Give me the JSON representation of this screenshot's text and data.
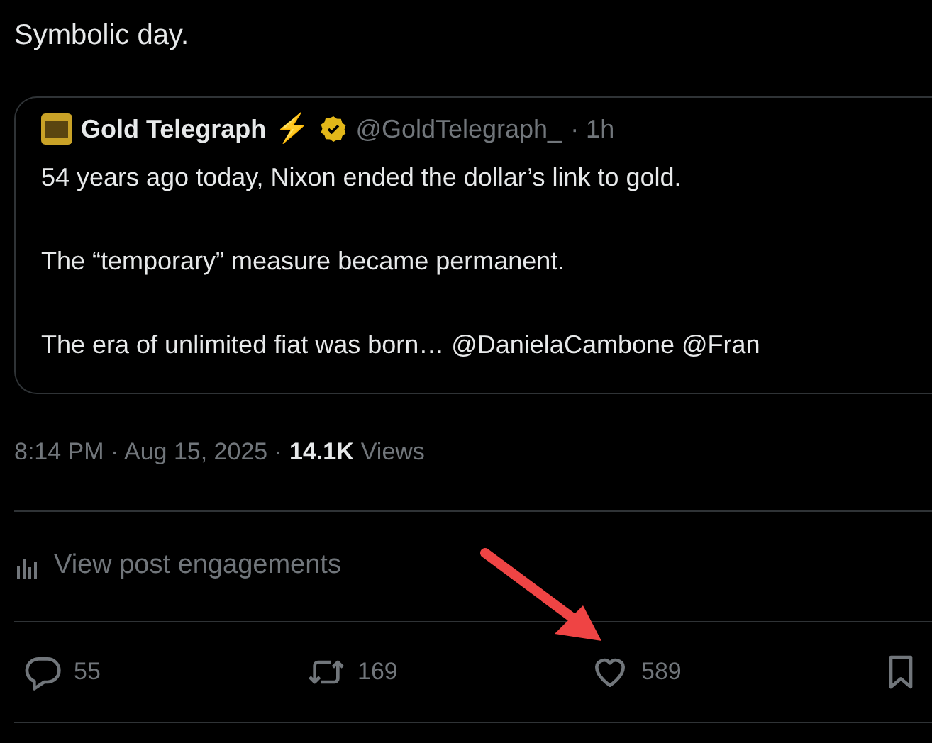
{
  "post_text": "Symbolic day.",
  "quoted_post": {
    "author": {
      "name": "Gold Telegraph",
      "emoji": "⚡",
      "verified": true,
      "handle": "@GoldTelegraph_",
      "time": "· 1h"
    },
    "paragraphs": [
      "54 years ago today, Nixon ended the dollar’s link to gold.",
      "The “temporary” measure became permanent.",
      "The era of unlimited fiat was born… @DanielaCambone @Fran"
    ]
  },
  "meta": {
    "timestamp": "8:14 PM · Aug 15, 2025 ·",
    "views_count": "14.1K",
    "views_label": "Views"
  },
  "engagements_link": "View post engagements",
  "actions": [
    {
      "kind": "reply",
      "count": "55"
    },
    {
      "kind": "repost",
      "count": "169"
    },
    {
      "kind": "like",
      "count": "589"
    },
    {
      "kind": "bookmark"
    }
  ]
}
